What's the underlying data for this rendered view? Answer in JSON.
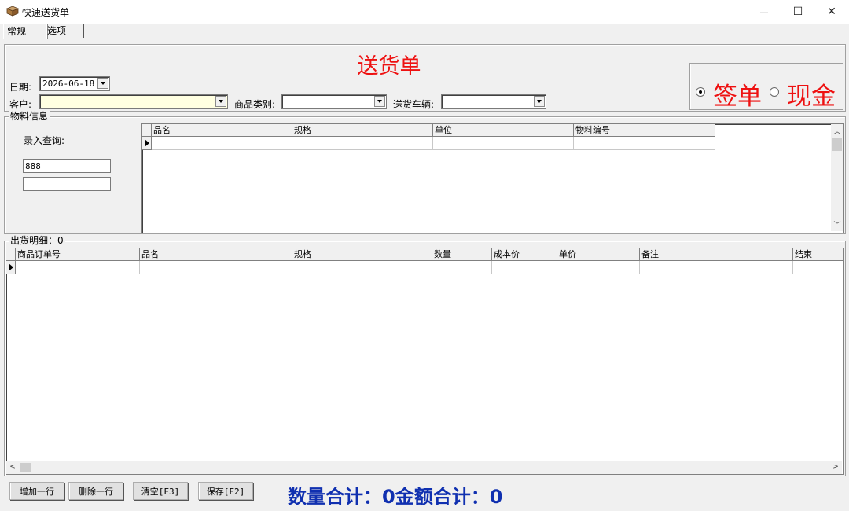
{
  "window": {
    "title": "快速送货单",
    "minimize": "—",
    "maximize": "☐",
    "close": "✕"
  },
  "tabs": [
    {
      "label": "常规"
    },
    {
      "label": "选项"
    }
  ],
  "header": {
    "title": "送货单",
    "date_label": "日期:",
    "date_value": "2026-06-18",
    "customer_label": "客户:",
    "customer_value": "",
    "category_label": "商品类别:",
    "category_value": "",
    "vehicle_label": "送货车辆:",
    "vehicle_value": ""
  },
  "payment": {
    "options": [
      {
        "label": "签单",
        "selected": true
      },
      {
        "label": "现金",
        "selected": false
      }
    ]
  },
  "material": {
    "group_title": "物料信息",
    "query_label": "录入查询:",
    "query_value": "888",
    "second_value": "",
    "columns": [
      "品名",
      "规格",
      "单位",
      "物料编号"
    ]
  },
  "shipment": {
    "group_title": "出货明细：0",
    "columns": [
      "商品订单号",
      "品名",
      "规格",
      "数量",
      "成本价",
      "单价",
      "备注",
      "结束"
    ]
  },
  "buttons": {
    "add_row": "增加一行",
    "delete_row": "删除一行",
    "clear": "清空[F3]",
    "save": "保存[F2]"
  },
  "totals": {
    "text": "数量合计：0金额合计：0"
  },
  "colors": {
    "title_red": "#ee1111",
    "totals_blue": "#1030b0"
  }
}
